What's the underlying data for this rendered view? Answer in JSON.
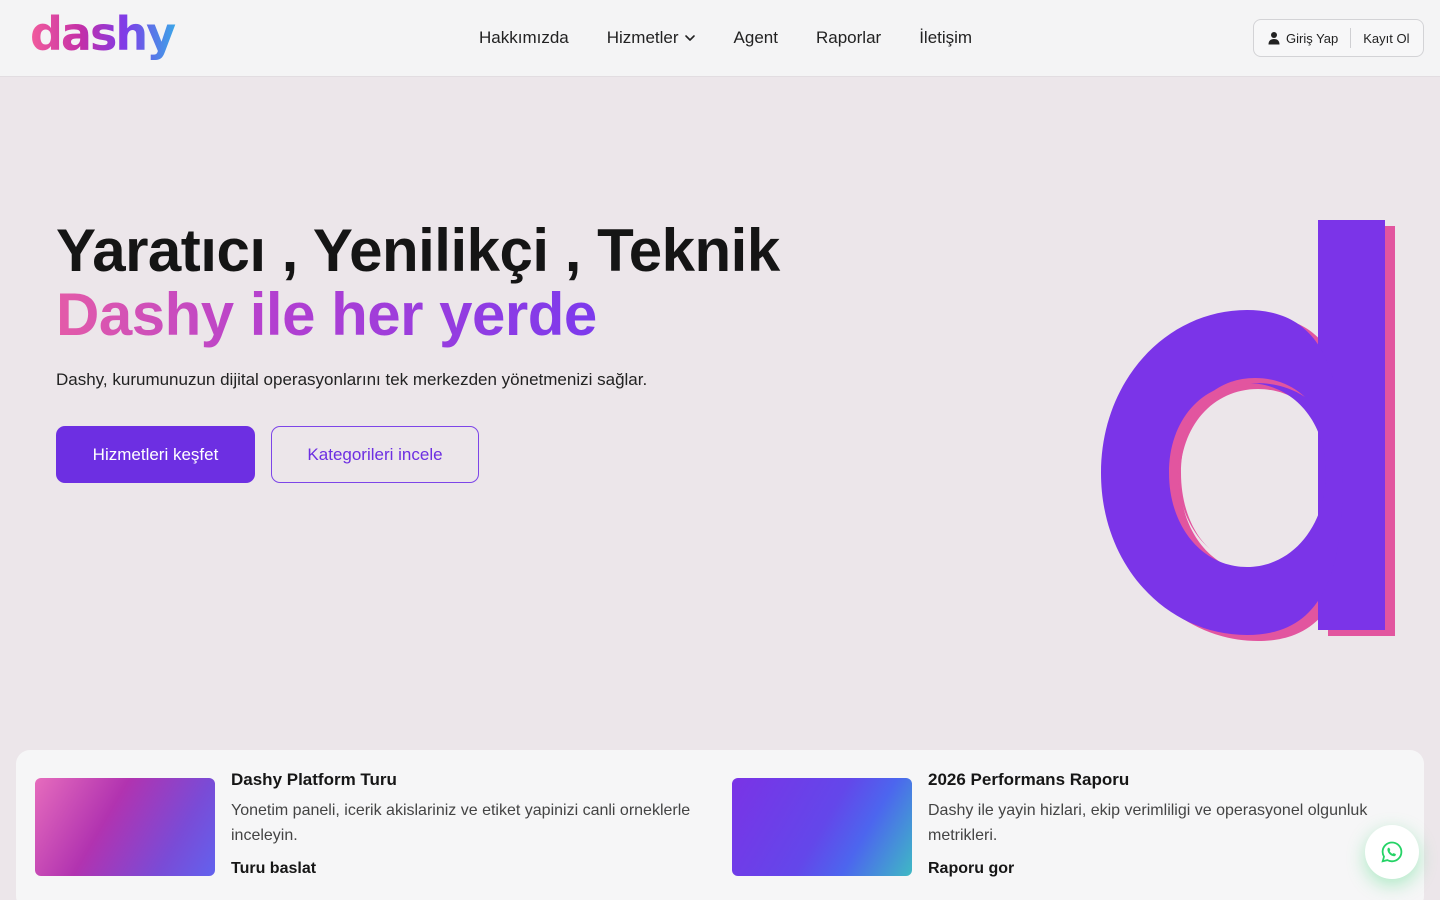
{
  "header": {
    "logo_text": "dashy",
    "nav": [
      {
        "label": "Hakkımızda"
      },
      {
        "label": "Hizmetler",
        "has_dropdown": true
      },
      {
        "label": "Agent"
      },
      {
        "label": "Raporlar"
      },
      {
        "label": "İletişim"
      }
    ],
    "login_label": "Giriş Yap",
    "register_label": "Kayıt Ol"
  },
  "hero": {
    "title": "Yaratıcı , Yenilikçi , Teknik",
    "title_gradient": "Dashy ile her yerde",
    "subtitle": "Dashy, kurumunuzun dijital operasyonlarını tek merkezden yönetmenizi sağlar.",
    "primary_button": "Hizmetleri keşfet",
    "secondary_button": "Kategorileri incele",
    "decor_letter": "d"
  },
  "cards": [
    {
      "title": "Dashy Platform Turu",
      "description": "Yonetim paneli, icerik akislariniz ve etiket yapinizi canli orneklerle inceleyin.",
      "link": "Turu baslat"
    },
    {
      "title": "2026 Performans Raporu",
      "description": "Dashy ile yayin hizlari, ekip verimliligi ve operasyonel olgunluk metrikleri.",
      "link": "Raporu gor"
    }
  ],
  "colors": {
    "brand_purple": "#6d2fe2",
    "brand_pink": "#e45ba8",
    "background": "#ece6ea",
    "whatsapp_green": "#25d366"
  },
  "icons": {
    "user": "user-icon",
    "chevron": "chevron-down-icon",
    "whatsapp": "whatsapp-icon"
  }
}
